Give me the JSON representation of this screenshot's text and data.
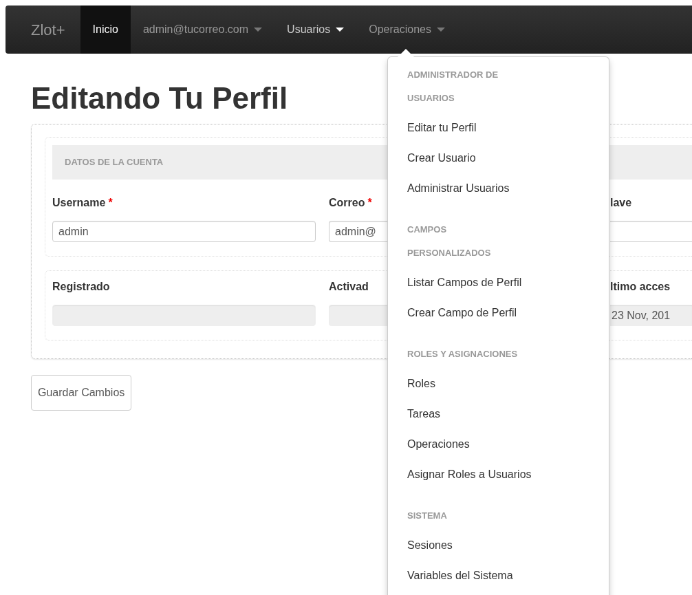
{
  "navbar": {
    "brand": "Zlot+",
    "items": [
      {
        "label": "Inicio",
        "selected": true,
        "dropdown": false,
        "open": false
      },
      {
        "label": "admin@tucorreo.com",
        "selected": false,
        "dropdown": true,
        "open": false
      },
      {
        "label": "Usuarios",
        "selected": false,
        "dropdown": true,
        "open": true
      },
      {
        "label": "Operaciones",
        "selected": false,
        "dropdown": true,
        "open": false
      }
    ]
  },
  "menu": {
    "sections": [
      {
        "header": "ADMINISTRADOR DE USUARIOS",
        "items": [
          "Editar tu Perfil",
          "Crear Usuario",
          "Administrar Usuarios"
        ]
      },
      {
        "header": "CAMPOS PERSONALIZADOS",
        "items": [
          "Listar Campos de Perfil",
          "Crear Campo de Perfil"
        ]
      },
      {
        "header": "ROLES Y ASIGNACIONES",
        "items": [
          "Roles",
          "Tareas",
          "Operaciones",
          "Asignar Roles a Usuarios"
        ]
      },
      {
        "header": "SISTEMA",
        "items": [
          "Sesiones",
          "Variables del Sistema"
        ]
      }
    ]
  },
  "page": {
    "title": "Editando Tu Perfil"
  },
  "form": {
    "fieldsets": [
      {
        "legend": "DATOS DE LA CUENTA",
        "fields": [
          {
            "label": "Username",
            "required_mark": "*",
            "disabled": false,
            "value": "admin"
          },
          {
            "label": "Correo",
            "required_mark": "*",
            "disabled": false,
            "value": "admin@"
          },
          {
            "label": "lave",
            "disabled": false
          }
        ]
      },
      {
        "fields": [
          {
            "label": "Registrado",
            "disabled": true
          },
          {
            "label": "Activad",
            "disabled": true
          },
          {
            "label": "ltimo acces",
            "disabled": true,
            "value": "23 Nov, 201"
          }
        ]
      }
    ],
    "submit": "Guardar Cambios"
  }
}
